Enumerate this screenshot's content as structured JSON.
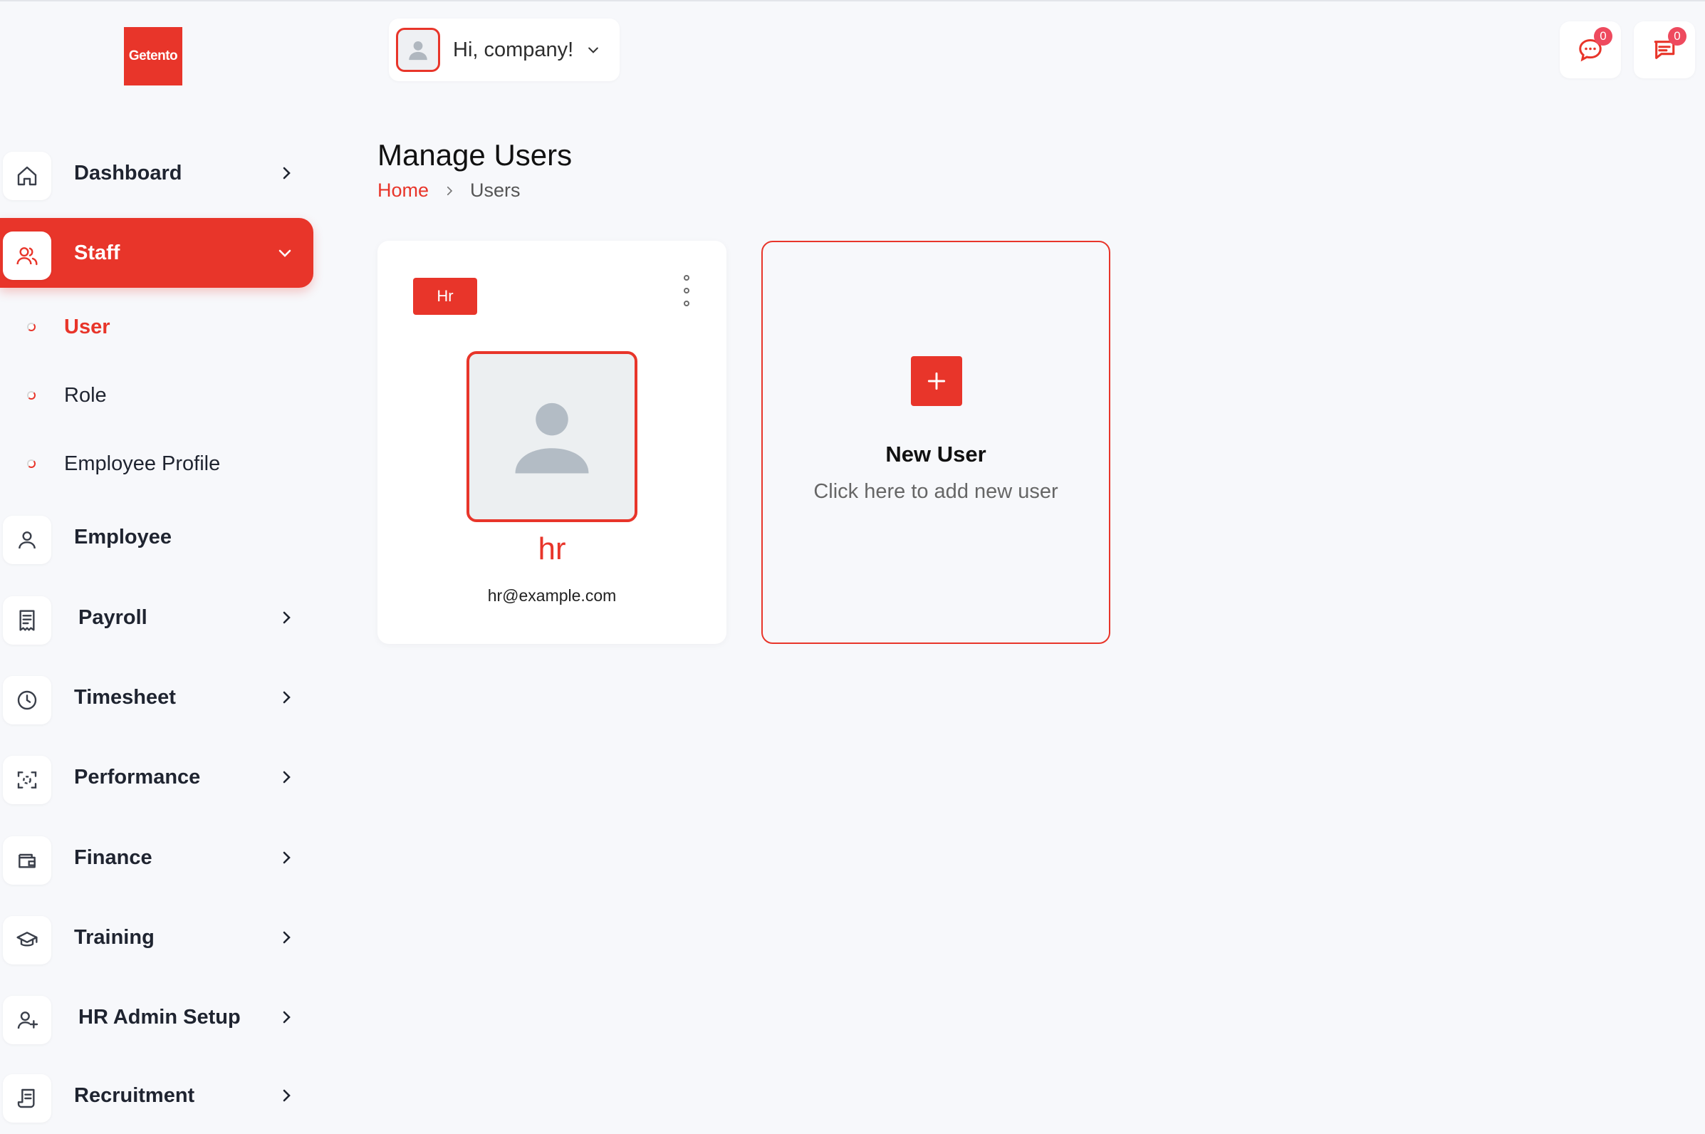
{
  "brand": {
    "logo_text": "Getento",
    "accent_color": "#e8352a"
  },
  "header": {
    "greeting": "Hi, company!",
    "messages_badge": "0",
    "notifications_badge": "0"
  },
  "sidebar": {
    "items": [
      {
        "label": "Dashboard",
        "icon": "home-icon"
      },
      {
        "label": "Staff",
        "icon": "users-icon"
      },
      {
        "label": "Employee",
        "icon": "user-icon"
      },
      {
        "label": "Payroll",
        "icon": "receipt-icon"
      },
      {
        "label": "Timesheet",
        "icon": "clock-icon"
      },
      {
        "label": "Performance",
        "icon": "target-icon"
      },
      {
        "label": "Finance",
        "icon": "wallet-icon"
      },
      {
        "label": "Training",
        "icon": "graduation-cap-icon"
      },
      {
        "label": "HR Admin Setup",
        "icon": "user-plus-icon"
      },
      {
        "label": "Recruitment",
        "icon": "document-icon"
      }
    ],
    "staff_subitems": [
      {
        "label": "User"
      },
      {
        "label": "Role"
      },
      {
        "label": "Employee Profile"
      }
    ]
  },
  "page": {
    "title": "Manage Users",
    "breadcrumb": {
      "home": "Home",
      "current": "Users"
    }
  },
  "users": [
    {
      "role": "Hr",
      "name": "hr",
      "email": "hr@example.com"
    }
  ],
  "new_user": {
    "title": "New User",
    "subtitle": "Click here to add new user"
  }
}
